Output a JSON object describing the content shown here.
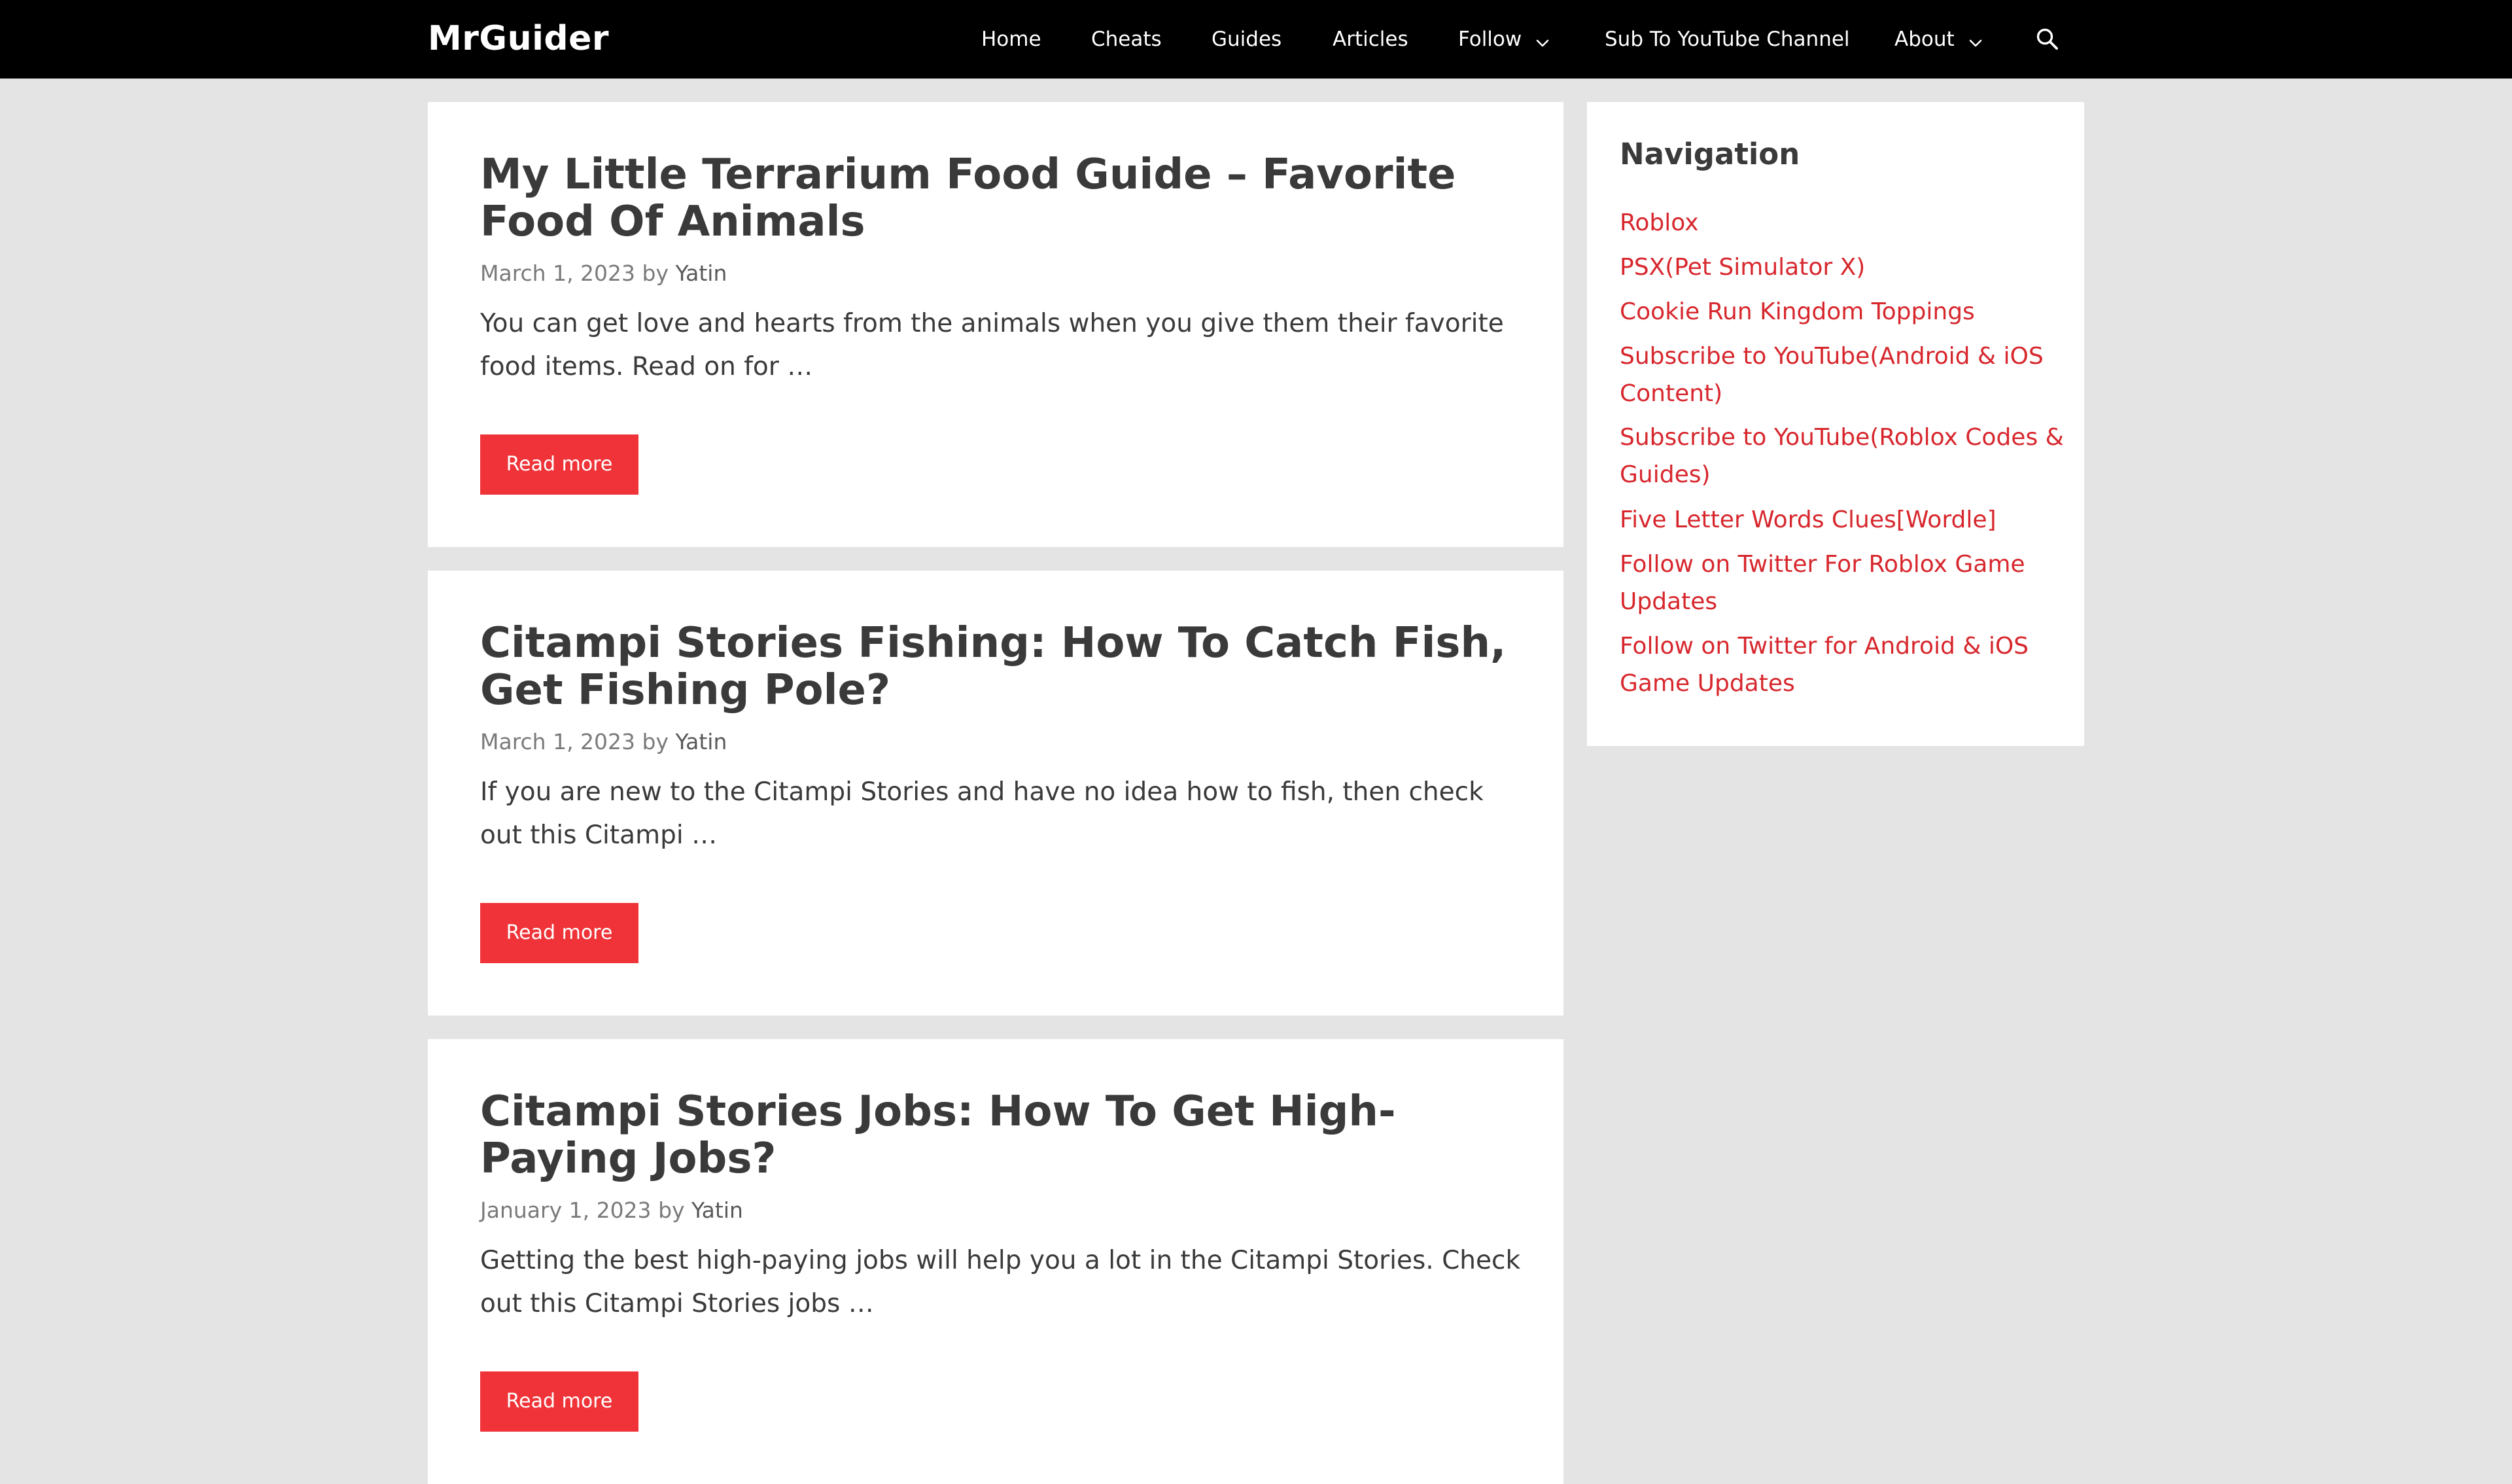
{
  "header": {
    "site_title": "MrGuider",
    "nav": [
      {
        "label": "Home"
      },
      {
        "label": "Cheats"
      },
      {
        "label": "Guides"
      },
      {
        "label": "Articles"
      },
      {
        "label": "Follow",
        "has_dropdown": true
      },
      {
        "label": "Sub To YouTube Channel"
      },
      {
        "label": "About",
        "has_dropdown": true
      }
    ],
    "search_icon": "search-icon"
  },
  "posts": [
    {
      "title": "My Little Terrarium Food Guide – Favorite Food Of Animals",
      "date": "March 1, 2023",
      "by": "by",
      "author": "Yatin",
      "excerpt": "You can get love and hearts from the animals when you give them their favorite food items. Read on for …",
      "read_more": "Read more"
    },
    {
      "title": "Citampi Stories Fishing: How To Catch Fish, Get Fishing Pole?",
      "date": "March 1, 2023",
      "by": "by",
      "author": "Yatin",
      "excerpt": "If you are new to the Citampi Stories and have no idea how to fish, then check out this Citampi …",
      "read_more": "Read more"
    },
    {
      "title": "Citampi Stories Jobs: How To Get High-Paying Jobs?",
      "date": "January 1, 2023",
      "by": "by",
      "author": "Yatin",
      "excerpt": "Getting the best high-paying jobs will help you a lot in the Citampi Stories. Check out this Citampi Stories jobs …",
      "read_more": "Read more"
    }
  ],
  "sidebar": {
    "title": "Navigation",
    "links": [
      {
        "label": "Roblox"
      },
      {
        "label": "PSX(Pet Simulator X)"
      },
      {
        "label": "Cookie Run Kingdom Toppings"
      },
      {
        "label": "Subscribe to YouTube(Android & iOS Content)"
      },
      {
        "label": "Subscribe to YouTube(Roblox Codes & Guides)"
      },
      {
        "label": "Five Letter Words Clues[Wordle]"
      },
      {
        "label": "Follow on Twitter For Roblox Game Updates"
      },
      {
        "label": "Follow on Twitter for Android & iOS Game Updates"
      }
    ]
  },
  "colors": {
    "header_bg": "#000000",
    "page_bg": "#e4e4e4",
    "accent": "#ef3338",
    "link": "#d7272d",
    "text": "#3a3a3a"
  }
}
